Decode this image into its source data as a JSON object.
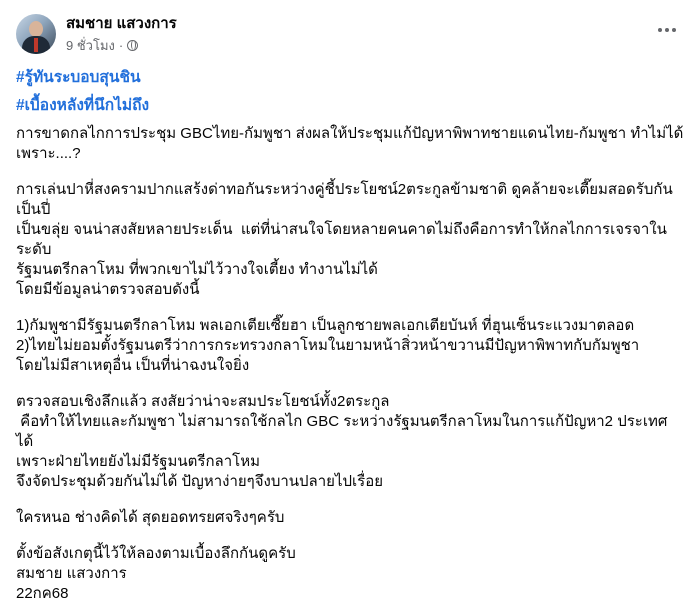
{
  "post": {
    "author": "สมชาย แสวงการ",
    "time": "9 ชั่วโมง",
    "separator": "·",
    "privacy_icon": "globe-icon",
    "more_icon": "more-options-icon",
    "hashtags": [
      "#รู้ทันระบอบสุนชิน",
      "#เบื้องหลังที่นึกไม่ถึง"
    ],
    "paragraphs": [
      "การขาดกลไกการประชุม GBCไทย-กัมพูชา ส่งผลให้ประชุมแก้ปัญหาพิพาทชายแดนไทย-กัมพูชา ทำไม่ได้\nเพราะ....?",
      "การเล่นปาหี่สงครามปากแสร้งด่าทอกันระหว่างคู่ชี้ประโยชน์2ตระกูลข้ามชาติ ดูคล้ายจะเตี๊ยมสอดรับกันเป็นปี่\nเป็นขลุ่ย จนน่าสงสัยหลายประเด็น  แต่ที่น่าสนใจโดยหลายคนคาดไม่ถึงคือการทำให้กลไกการเจรจาในระดับ\nรัฐมนตรีกลาโหม ที่พวกเขาไม่ไว้วางใจเตี้ยง ทำงานไม่ได้\nโดยมีข้อมูลน่าตรวจสอบดังนี้",
      "1)กัมพูชามีรัฐมนตรีกลาโหม พลเอกเตียเซี๊ยฮา เป็นลูกชายพลเอกเตียบันห์ ที่ฮุนเซ็นระแวงมาตลอด\n2)ไทยไม่ยอมตั้งรัฐมนตรีว่าการกระทรวงกลาโหมในยามหน้าสิ่วหน้าขวานมีปัญหาพิพาทกับกัมพูชา\nโดยไม่มีสาเหตุอื่น เป็นที่น่าฉงนใจยิ่ง",
      "ตรวจสอบเชิงลึกแล้ว สงสัยว่าน่าจะสมประโยชน์ทั้ง2ตระกูล\n คือทำให้ไทยและกัมพูชา ไม่สามารถใช้กลไก GBC ระหว่างรัฐมนตรีกลาโหมในการแก้ปัญหา2 ประเทศได้\nเพราะฝ่ายไทยยังไม่มีรัฐมนตรีกลาโหม\nจึงจัดประชุมด้วยกันไม่ได้ ปัญหาง่ายๆจึงบานปลายไปเรื่อย",
      "ใครหนอ ช่างคิดได้ สุดยอดทรยศจริงๆครับ",
      "ตั้งข้อสังเกตุนี้ไว้ให้ลองตามเบื้องลึกกันดูครับ\nสมชาย แสวงการ\n22กค68"
    ]
  }
}
